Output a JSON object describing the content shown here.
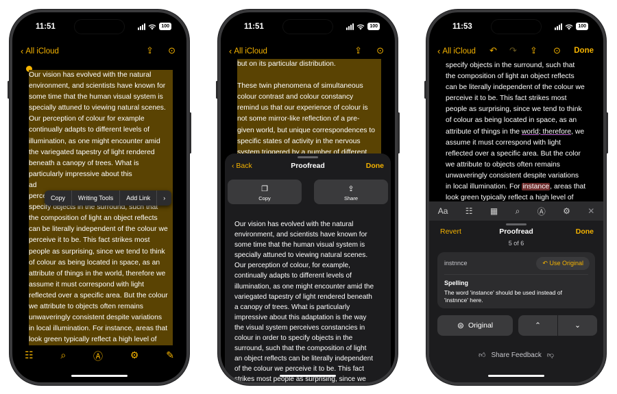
{
  "phones": [
    {
      "time": "11:51",
      "battery": "100",
      "back_label": "All iCloud",
      "context_menu": [
        "Copy",
        "Writing Tools",
        "Add Link",
        "›"
      ],
      "note_lines": [
        "Our vision has evolved with the natural",
        "environment, and scientists have known for",
        "some time that the human visual system is",
        "specially attuned to viewing natural scenes.",
        "Our perception of colour for example",
        "continually adapts to different levels of",
        "illumination, as one might encounter amid",
        "the variegated tapestry of light rendered",
        "beneath a canopy of trees. What is",
        "particularly impressive about this",
        "ad",
        "perceives constancies in colour in order to",
        "specify objects in the surround, such that",
        "the composition of light an object reflects",
        "can be literally independent of the colour we",
        "perceive it to be. This fact strikes most",
        "people as surprising, since we tend to think",
        "of colour as being located in space, as an",
        "attribute of things in the world, therefore we",
        "assume it must correspond with light",
        "reflected over a specific area. But the colour",
        "we attribute to objects often remains",
        "unwaveringly consistent despite variations",
        "in local illumination. For instance, areas that",
        "look green typically reflect a high level of"
      ]
    },
    {
      "time": "11:51",
      "battery": "100",
      "back_label": "All iCloud",
      "note_lines": [
        "but on its particular distribution.",
        "",
        "These twin phenomena of simultaneous",
        "colour contrast and colour constancy",
        "remind us that our experience of colour is",
        "not some mirror-like reflection of a pre-",
        "given world, but unique correspondences to",
        "specific states of activity in the nervous",
        "system triggered by a number of different"
      ],
      "sheet": {
        "back": "Back",
        "title": "Proofread",
        "done": "Done",
        "copy_label": "Copy",
        "share_label": "Share"
      },
      "proof_lines": [
        "Our vision has evolved with the natural",
        "environment, and scientists have known for",
        "some time that the human visual system is",
        "specially attuned to viewing natural scenes.",
        "Our perception of colour, for example,",
        "continually adapts to different levels of",
        "illumination, as one might encounter amid the",
        "variegated tapestry of light rendered beneath",
        "a canopy of trees. What is particularly",
        "impressive about this adaptation is the way",
        "the visual system perceives constancies in",
        "colour in order to specify objects in the",
        "surround, such that the composition of light",
        "an object reflects can be literally independent",
        "of the colour we perceive it to be. This fact",
        "strikes most people as surprising, since we"
      ]
    },
    {
      "time": "11:53",
      "battery": "100",
      "back_label": "All iCloud",
      "done": "Done",
      "note_lines": [
        "specify objects in the surround, such that",
        "the composition of light an object reflects",
        "can be literally independent of the colour we",
        "perceive it to be. This fact strikes most",
        "people as surprising, since we tend to think",
        "of colour as being located in space, as an"
      ],
      "line_world_a": "attribute of things in the ",
      "line_world_b": "world; therefore,",
      "line_world_c": " we",
      "note_lines_b": [
        "assume it must correspond with light",
        "reflected over a specific area. But the color",
        "we attribute to objects often remains",
        "unwaveringly consistent despite variations"
      ],
      "line_instance_a": "in local illumination. For ",
      "line_instance_b": "instance",
      "line_instance_c": ", areas that",
      "last_line": "look green typically reflect a high level of",
      "format_icons": [
        "Aa",
        "checklist-icon",
        "table-icon",
        "attachment-icon",
        "markup-icon",
        "writing-tools-icon",
        "close-icon"
      ],
      "panel": {
        "revert": "Revert",
        "title": "Proofread",
        "counter": "5 of 6",
        "done": "Done",
        "misspelled": "instnnce",
        "use_original": "Use Original",
        "heading": "Spelling",
        "description_1": "The word 'instance' should be used instead of",
        "description_2": "'instnnce' here.",
        "original_label": "Original",
        "feedback_label": "Share Feedback"
      }
    }
  ],
  "colors": {
    "accent": "#f5b300",
    "highlight": "#5a4303"
  }
}
